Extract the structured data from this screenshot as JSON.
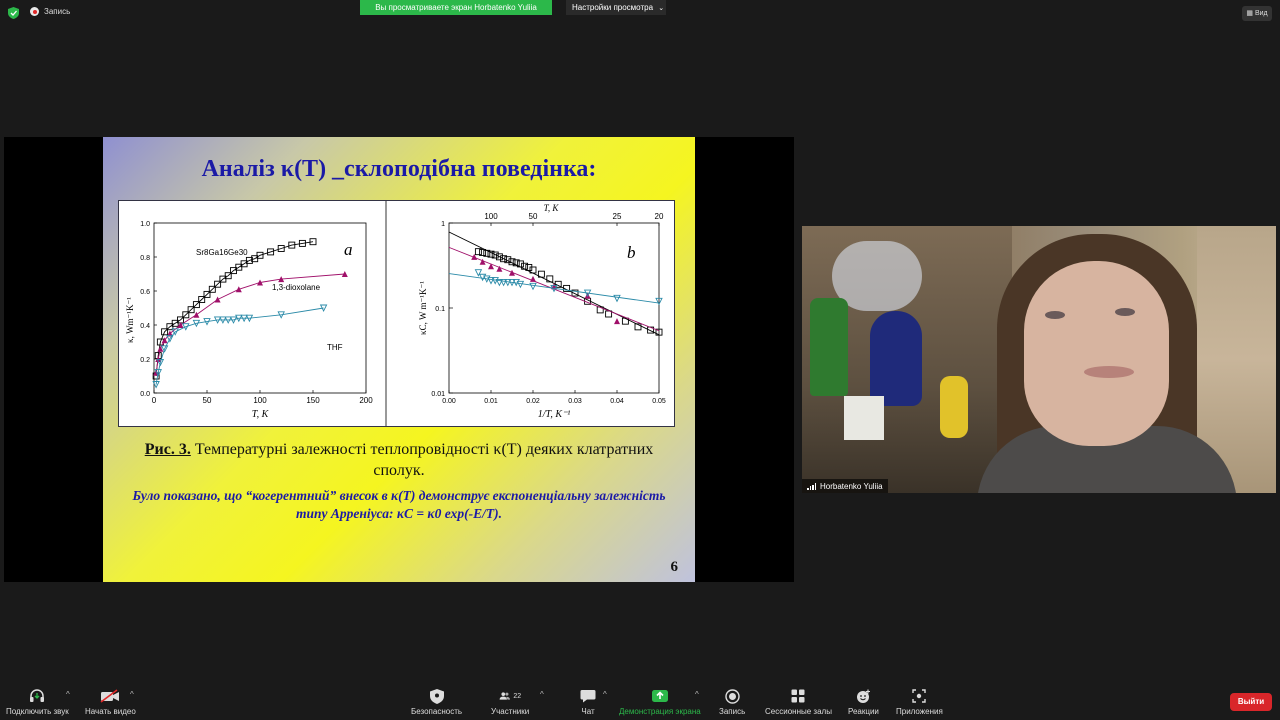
{
  "topbar": {
    "record_label": "Запись",
    "share_banner": "Вы просматриваете экран Horbatenko Yuliia",
    "view_settings": "Настройки просмотра",
    "view_button": "Вид"
  },
  "slide": {
    "title": "Аналіз κ(T) _склоподібна поведінка:",
    "caption_label": "Рис. 3.",
    "caption_text": " Температурні залежності теплопровідності κ(T) деяких клатратних сполук.",
    "note": "Було показано, що “когерентний” внесок в κ(T) демонструє експоненціальну залежність типу Арреніуса: κC = κ0 exp(-E/T).",
    "page_number": "6"
  },
  "chart_data": [
    {
      "type": "scatter",
      "panel_label": "a",
      "xlabel": "T, K",
      "ylabel": "κ, Wm⁻¹K⁻¹",
      "xlim": [
        0,
        200
      ],
      "ylim": [
        0,
        1.0
      ],
      "x_ticks": [
        "0",
        "50",
        "100",
        "150",
        "200"
      ],
      "y_ticks": [
        "0.0",
        "0.2",
        "0.4",
        "0.6",
        "0.8",
        "1.0"
      ],
      "series": [
        {
          "name": "Sr8Ga16Ge30",
          "color": "#000000",
          "marker": "square",
          "x": [
            2,
            4,
            6,
            10,
            15,
            20,
            25,
            30,
            35,
            40,
            45,
            50,
            55,
            60,
            65,
            70,
            75,
            80,
            85,
            90,
            95,
            100,
            110,
            120,
            130,
            140,
            150
          ],
          "y": [
            0.1,
            0.22,
            0.3,
            0.36,
            0.39,
            0.41,
            0.43,
            0.46,
            0.49,
            0.52,
            0.55,
            0.58,
            0.61,
            0.64,
            0.67,
            0.69,
            0.72,
            0.74,
            0.76,
            0.78,
            0.79,
            0.81,
            0.83,
            0.85,
            0.87,
            0.88,
            0.89
          ]
        },
        {
          "name": "1,3-dioxolane",
          "color": "#a0106a",
          "marker": "triangle-up",
          "x": [
            2,
            4,
            6,
            10,
            15,
            25,
            40,
            60,
            80,
            100,
            120,
            180
          ],
          "y": [
            0.12,
            0.2,
            0.26,
            0.31,
            0.35,
            0.4,
            0.46,
            0.55,
            0.61,
            0.65,
            0.67,
            0.7
          ]
        },
        {
          "name": "THF",
          "color": "#2a8aa8",
          "marker": "triangle-down",
          "x": [
            2,
            4,
            6,
            10,
            15,
            20,
            30,
            40,
            50,
            60,
            65,
            70,
            75,
            80,
            85,
            90,
            120,
            160
          ],
          "y": [
            0.05,
            0.12,
            0.18,
            0.26,
            0.32,
            0.36,
            0.39,
            0.41,
            0.42,
            0.43,
            0.43,
            0.43,
            0.43,
            0.44,
            0.44,
            0.44,
            0.46,
            0.5
          ]
        }
      ]
    },
    {
      "type": "scatter",
      "panel_label": "b",
      "xlabel": "1/T, K⁻¹",
      "ylabel": "κC, W m⁻¹K⁻¹",
      "top_xlabel": "T, K",
      "scale_y": "log",
      "xlim": [
        0.0,
        0.05
      ],
      "ylim": [
        0.01,
        1
      ],
      "x_ticks": [
        "0.00",
        "0.01",
        "0.02",
        "0.03",
        "0.04",
        "0.05"
      ],
      "y_ticks": [
        "1",
        "0.1",
        "0.01"
      ],
      "top_ticks": [
        "100",
        "50",
        "25",
        "20"
      ],
      "series": [
        {
          "name": "Sr8Ga16Ge30",
          "color": "#000000",
          "marker": "square",
          "x": [
            0.007,
            0.008,
            0.009,
            0.01,
            0.011,
            0.012,
            0.013,
            0.014,
            0.015,
            0.016,
            0.017,
            0.018,
            0.019,
            0.02,
            0.022,
            0.024,
            0.026,
            0.028,
            0.03,
            0.033,
            0.036,
            0.038,
            0.042,
            0.045,
            0.048,
            0.05
          ],
          "y": [
            0.46,
            0.45,
            0.44,
            0.43,
            0.42,
            0.4,
            0.38,
            0.37,
            0.35,
            0.34,
            0.33,
            0.31,
            0.3,
            0.28,
            0.25,
            0.22,
            0.19,
            0.17,
            0.15,
            0.12,
            0.095,
            0.085,
            0.07,
            0.06,
            0.055,
            0.052
          ]
        },
        {
          "name": "1,3-dioxolane",
          "color": "#a0106a",
          "marker": "triangle-up",
          "x": [
            0.006,
            0.008,
            0.01,
            0.012,
            0.015,
            0.02,
            0.025,
            0.033,
            0.04
          ],
          "y": [
            0.4,
            0.35,
            0.31,
            0.29,
            0.26,
            0.22,
            0.18,
            0.14,
            0.07
          ]
        },
        {
          "name": "THF",
          "color": "#2a8aa8",
          "marker": "triangle-down",
          "x": [
            0.007,
            0.008,
            0.009,
            0.01,
            0.011,
            0.012,
            0.013,
            0.014,
            0.015,
            0.016,
            0.017,
            0.02,
            0.025,
            0.033,
            0.04,
            0.05
          ],
          "y": [
            0.26,
            0.23,
            0.22,
            0.21,
            0.21,
            0.2,
            0.2,
            0.2,
            0.2,
            0.2,
            0.19,
            0.18,
            0.17,
            0.15,
            0.13,
            0.12
          ]
        }
      ]
    }
  ],
  "video": {
    "participant_name": "Horbatenko Yuliia"
  },
  "toolbar": {
    "audio": "Подключить звук",
    "video": "Начать видео",
    "security": "Безопасность",
    "participants": "Участники",
    "participants_count": "22",
    "chat": "Чат",
    "share": "Демонстрация экрана",
    "record": "Запись",
    "breakout": "Сессионные залы",
    "reactions": "Реакции",
    "apps": "Приложения",
    "leave": "Выйти"
  },
  "colors": {
    "share_green": "#2cb84a",
    "leave_red": "#d9262a",
    "slide_title_blue": "#1b1aa6"
  }
}
